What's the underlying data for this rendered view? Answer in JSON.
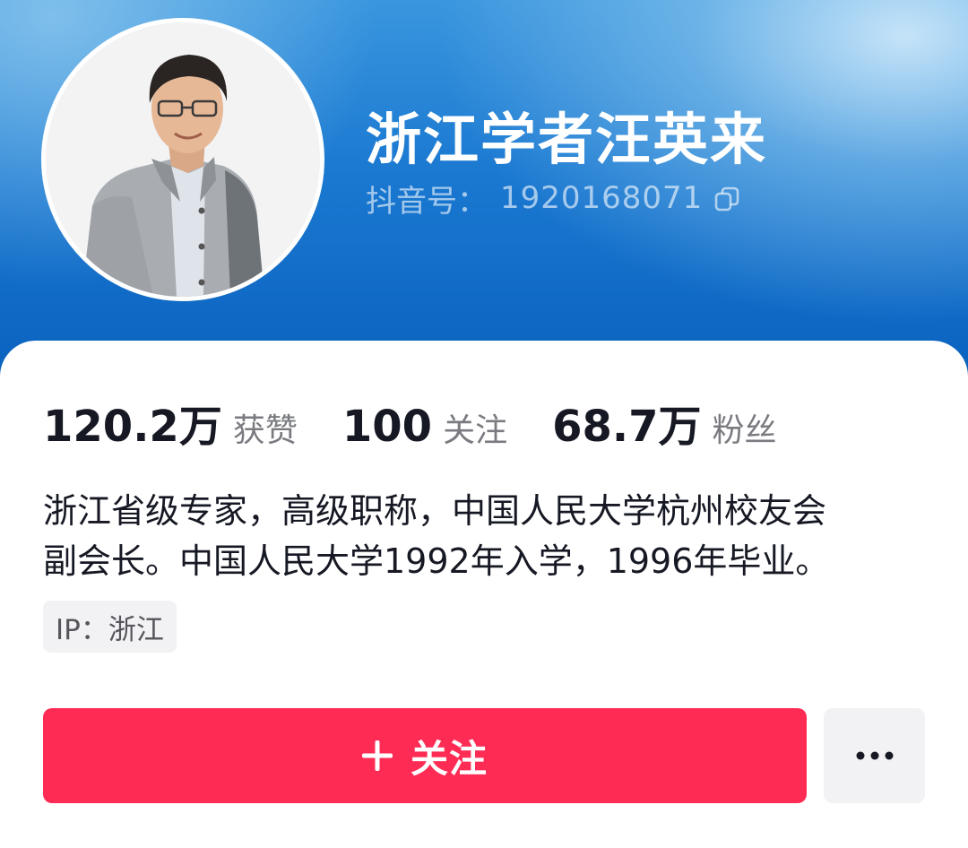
{
  "profile": {
    "name": "浙江学者汪英来",
    "douyin_id_label": "抖音号：",
    "douyin_id": "1920168071"
  },
  "stats": [
    {
      "value": "120.2万",
      "label": "获赞"
    },
    {
      "value": "100",
      "label": "关注"
    },
    {
      "value": "68.7万",
      "label": "粉丝"
    }
  ],
  "bio": {
    "line1": "浙江省级专家，高级职称，中国人民大学杭州校友会",
    "line2": "副会长。中国人民大学1992年入学，1996年毕业。"
  },
  "ip": {
    "text": "IP：浙江"
  },
  "actions": {
    "follow_label": "关注",
    "more_icon": "more-dots-icon",
    "follow_icon": "plus-icon"
  },
  "colors": {
    "accent": "#fe2c55",
    "header_blue": "#1b79d1",
    "text_primary": "#161823",
    "text_secondary": "#7a7b80"
  }
}
